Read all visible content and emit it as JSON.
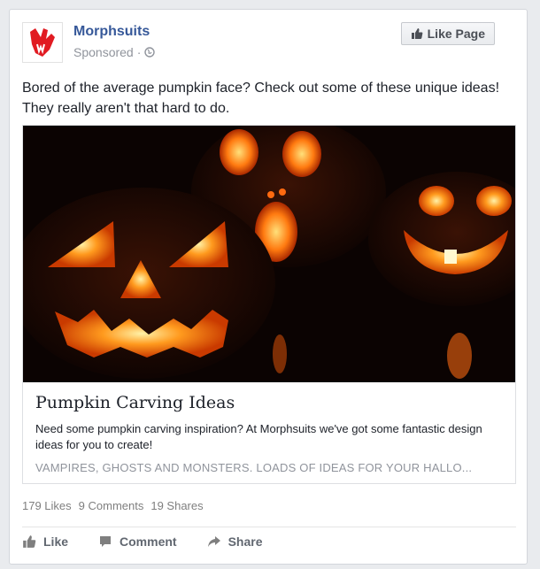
{
  "post": {
    "page_name": "Morphsuits",
    "sponsored_label": "Sponsored",
    "separator": "·",
    "like_page_label": "Like Page",
    "text": "Bored of the average pumpkin face? Check out some of these unique ideas! They really aren't that hard to do."
  },
  "link_preview": {
    "title": "Pumpkin Carving Ideas",
    "description": "Need some pumpkin carving inspiration? At Morphsuits we've got some fantastic design ideas for you to create!",
    "domain_text": "VAMPIRES, GHOSTS AND MONSTERS. LOADS OF IDEAS FOR YOUR HALLO..."
  },
  "stats": {
    "likes": "179 Likes",
    "comments": "9 Comments",
    "shares": "19 Shares"
  },
  "actions": {
    "like": "Like",
    "comment": "Comment",
    "share": "Share"
  },
  "colors": {
    "brand_blue": "#365899",
    "logo_red": "#e11b22",
    "pumpkin_glow": "#ff8a1c"
  },
  "icons": {
    "avatar": "morphsuits-logo-icon",
    "privacy": "globe-icon",
    "like_page": "thumbs-up-icon",
    "like": "thumbs-up-icon",
    "comment": "comment-bubble-icon",
    "share": "share-arrow-icon"
  }
}
